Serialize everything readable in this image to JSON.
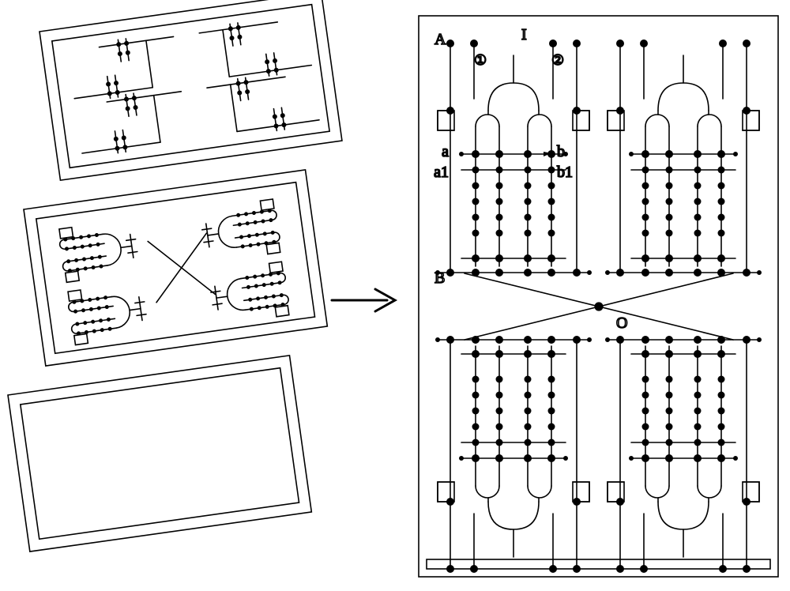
{
  "labels": {
    "A": "A",
    "B": "B",
    "I": "I",
    "O": "O",
    "a": "a",
    "b": "b",
    "a1": "a1",
    "b1": "b1",
    "one": "①",
    "two": "②"
  }
}
